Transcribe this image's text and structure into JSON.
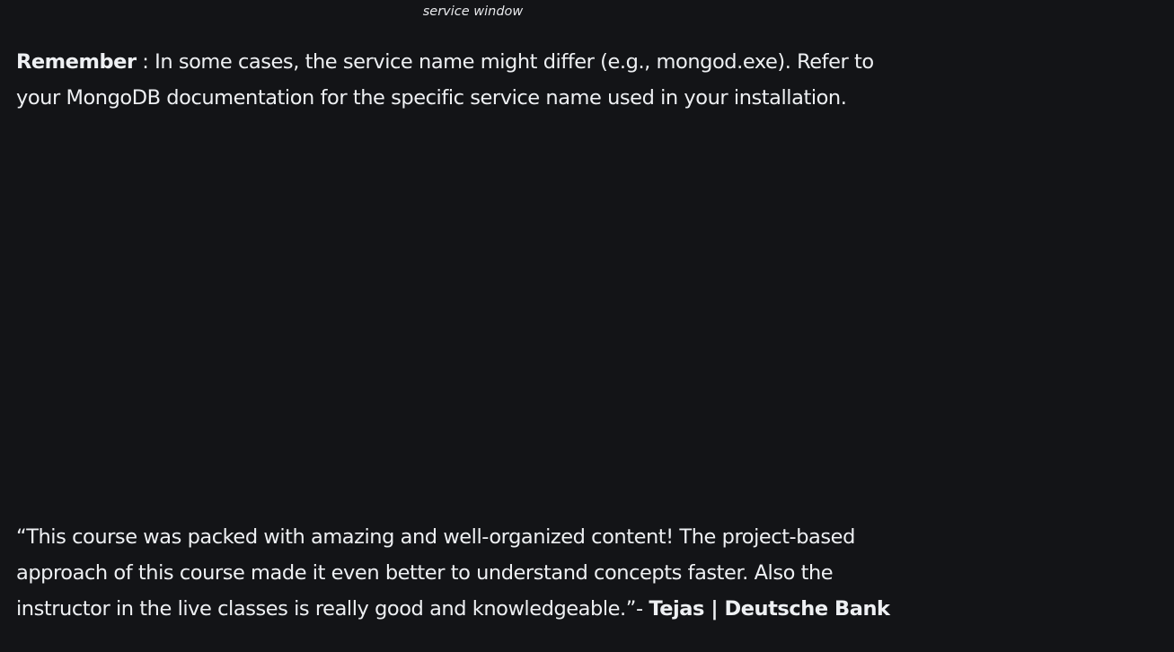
{
  "caption": "service window",
  "remember": {
    "label": "Remember",
    "text": " : In some cases, the service name might differ (e.g., mongod.exe). Refer to your MongoDB documentation for the specific service name used in your installation."
  },
  "testimonial": {
    "quote": "“This course was packed with amazing and well-organized content! The project-based approach of this course made it even better to understand concepts faster. Also the instructor in the live classes is really good and knowledgeable.”- ",
    "author": "Tejas | Deutsche Bank"
  }
}
